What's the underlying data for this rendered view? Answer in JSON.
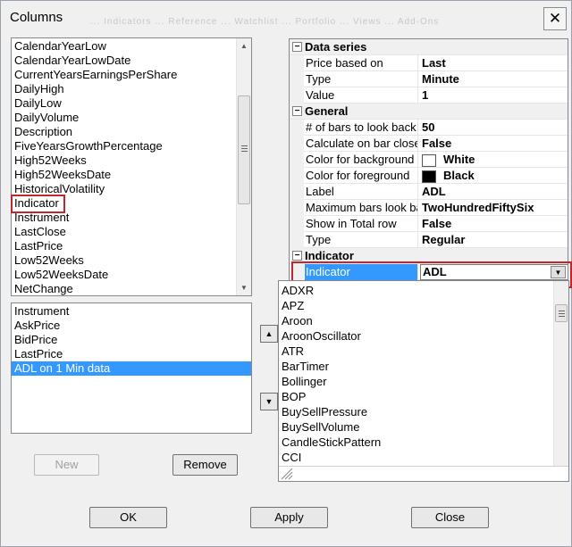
{
  "window": {
    "title": "Columns",
    "background_text": "... Indicators ... Reference ... Watchlist ... Portfolio ... Views ... Add-Ons"
  },
  "available_columns": [
    "CalendarYearLow",
    "CalendarYearLowDate",
    "CurrentYearsEarningsPerShare",
    "DailyHigh",
    "DailyLow",
    "DailyVolume",
    "Description",
    "FiveYearsGrowthPercentage",
    "High52Weeks",
    "High52WeeksDate",
    "HistoricalVolatility",
    "Indicator",
    "Instrument",
    "LastClose",
    "LastPrice",
    "Low52Weeks",
    "Low52WeeksDate",
    "NetChange"
  ],
  "selected_columns": [
    "Instrument",
    "AskPrice",
    "BidPrice",
    "LastPrice",
    "ADL on 1 Min data"
  ],
  "selected_index": 4,
  "buttons": {
    "new": "New",
    "remove": "Remove",
    "ok": "OK",
    "apply": "Apply",
    "close": "Close"
  },
  "properties": {
    "sections": [
      {
        "name": "Data series",
        "rows": [
          {
            "name": "Price based on",
            "value": "Last"
          },
          {
            "name": "Type",
            "value": "Minute"
          },
          {
            "name": "Value",
            "value": "1"
          }
        ]
      },
      {
        "name": "General",
        "rows": [
          {
            "name": "# of bars to look back",
            "value": "50"
          },
          {
            "name": "Calculate on bar close",
            "value": "False"
          },
          {
            "name": "Color for background",
            "value": "White",
            "swatch": "#ffffff"
          },
          {
            "name": "Color for foreground",
            "value": "Black",
            "swatch": "#000000"
          },
          {
            "name": "Label",
            "value": "ADL"
          },
          {
            "name": "Maximum bars look back",
            "value": "TwoHundredFiftySix"
          },
          {
            "name": "Show in Total row",
            "value": "False"
          },
          {
            "name": "Type",
            "value": "Regular"
          }
        ]
      },
      {
        "name": "Indicator",
        "rows": [
          {
            "name": "Indicator",
            "value": "ADL",
            "selected": true
          }
        ]
      }
    ]
  },
  "indicator_options": [
    "ADXR",
    "APZ",
    "Aroon",
    "AroonOscillator",
    "ATR",
    "BarTimer",
    "Bollinger",
    "BOP",
    "BuySellPressure",
    "BuySellVolume",
    "CandleStickPattern",
    "CCI"
  ],
  "colors": {
    "selection": "#3399ff",
    "highlight_box": "#c0282d"
  }
}
